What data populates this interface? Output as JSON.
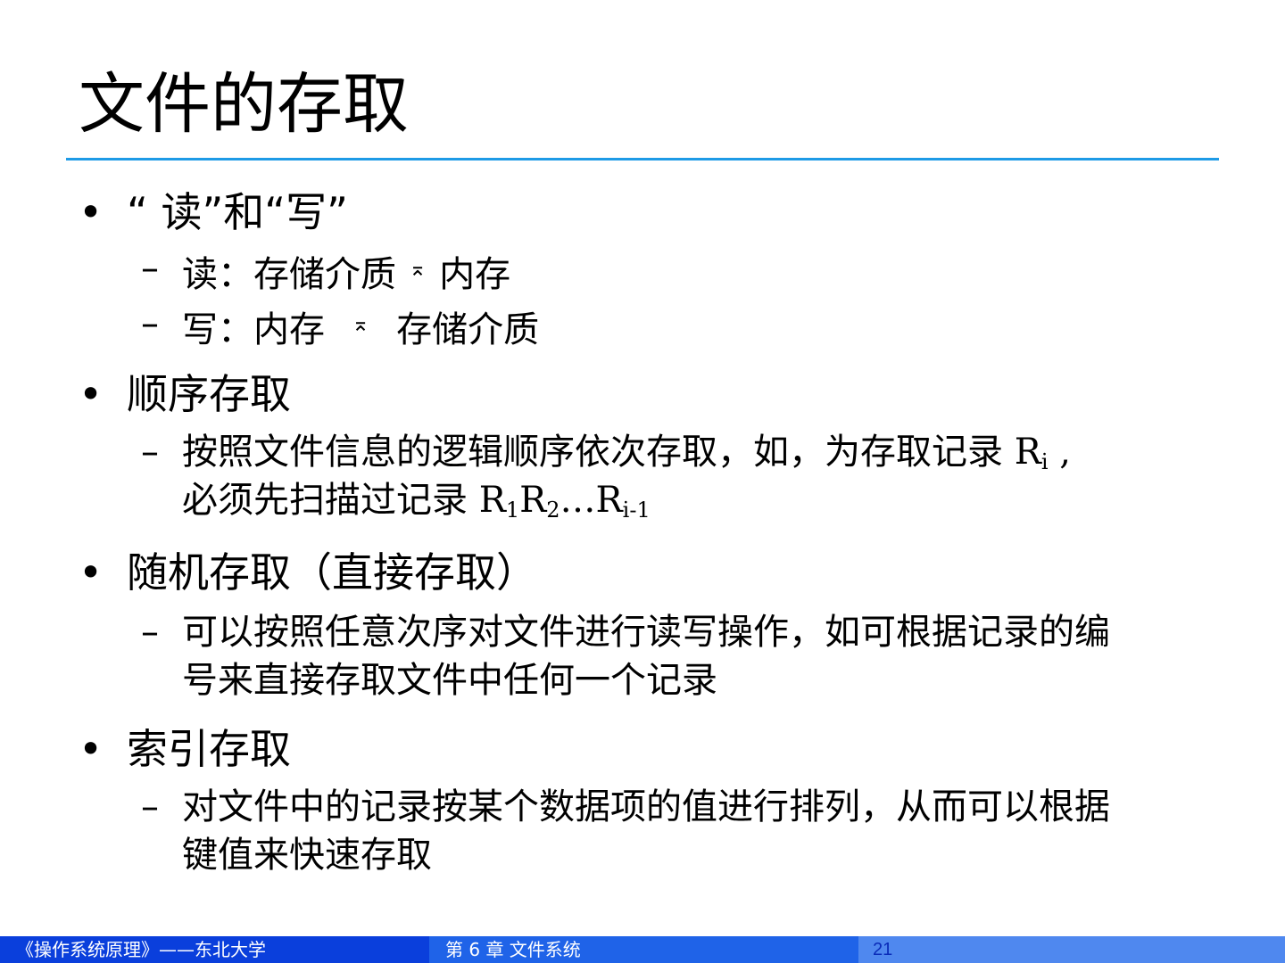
{
  "slide": {
    "title": "文件的存取"
  },
  "sections": [
    {
      "heading": "“ 读”和“写”",
      "items": [
        {
          "text": "读：存储介质",
          "arrow": "⌅",
          "after": "内存"
        },
        {
          "text": "写：内存",
          "arrow": "⌅",
          "after": "存储介质"
        }
      ]
    },
    {
      "heading": "顺序存取",
      "items": [
        {
          "line1_pre": "按照文件信息的逻辑顺序依次存取，如，为存取记录 R",
          "line1_sub": "i",
          "line1_post": " ,",
          "line2_pre": "必须先扫描过记录 R",
          "line2_sub1": "1",
          "line2_mid": "R",
          "line2_sub2": "2",
          "line2_mid2": "…R",
          "line2_sub3": "i-1"
        }
      ]
    },
    {
      "heading": "随机存取（直接存取）",
      "items": [
        {
          "line1": "可以按照任意次序对文件进行读写操作，如可根据记录的编",
          "line2": "号来直接存取文件中任何一个记录"
        }
      ]
    },
    {
      "heading": "索引存取",
      "items": [
        {
          "line1": "对文件中的记录按某个数据项的值进行排列，从而可以根据",
          "line2": "键值来快速存取"
        }
      ]
    }
  ],
  "bullet_glyph": "•",
  "dash_glyph": "–",
  "footer": {
    "course": "《操作系统原理》——东北大学",
    "chapter": "第 6 章  文件系统",
    "page": "21"
  },
  "colors": {
    "title_rule": "#1e9be6",
    "footer_left": "#0a3fdc",
    "footer_mid": "#1f63e8",
    "footer_right": "#4f88ef"
  }
}
